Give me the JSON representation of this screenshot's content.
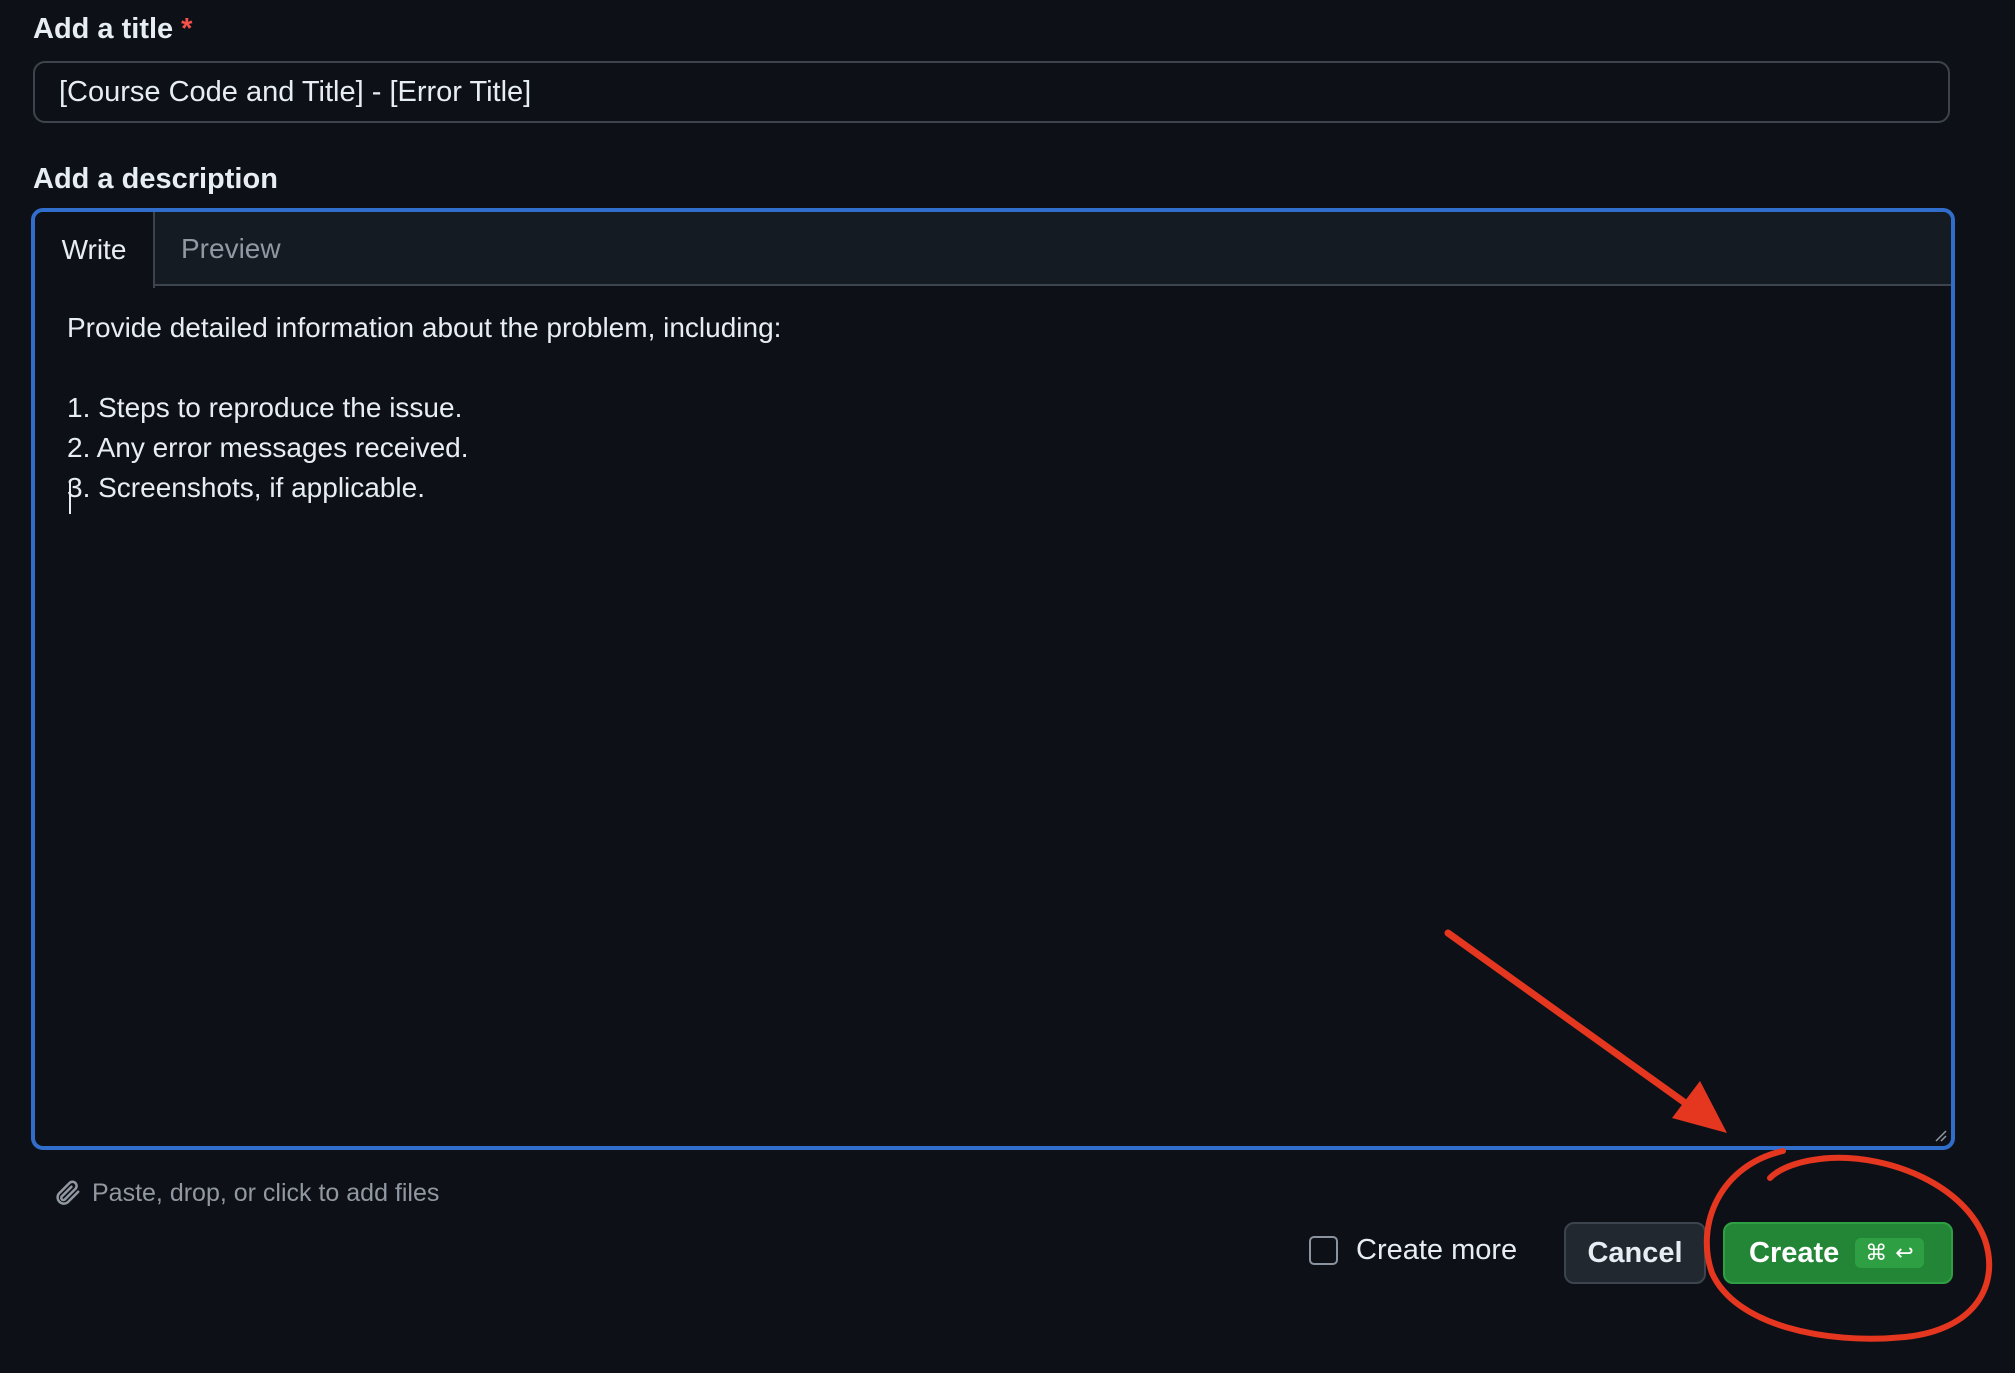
{
  "form": {
    "title_label": "Add a title",
    "required_mark": "*",
    "title_value": "[Course Code and Title] - [Error Title]",
    "description_label": "Add a description"
  },
  "editor": {
    "tabs": [
      {
        "label": "Write",
        "active": true
      },
      {
        "label": "Preview",
        "active": false
      }
    ],
    "toolbar": [
      "heading-icon",
      "bold-icon",
      "italic-icon",
      "quote-icon",
      "code-icon",
      "link-icon",
      "unordered-list-icon",
      "ordered-list-icon",
      "task-list-icon",
      "mention-icon",
      "cross-reference-icon",
      "reply-icon",
      "slash-commands-icon"
    ],
    "body_text": "Provide detailed information about the problem, including:\n\n1. Steps to reproduce the issue.\n2. Any error messages received.\n3. Screenshots, if applicable.\n",
    "focus_color": "#316dca"
  },
  "attachments": {
    "hint": "Paste, drop, or click to add files"
  },
  "footer": {
    "create_more_label": "Create more",
    "create_more_checked": false,
    "cancel_label": "Cancel",
    "create_label": "Create",
    "create_shortcut_cmd": "⌘",
    "create_shortcut_enter": "↩"
  },
  "colors": {
    "background": "#0d1117",
    "primary_button": "#238636",
    "annotation": "#e5361f"
  }
}
